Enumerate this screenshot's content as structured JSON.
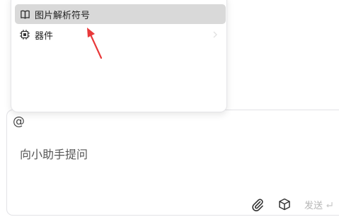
{
  "menu": {
    "items": [
      {
        "label": "图片解析符号",
        "icon": "book-open-icon",
        "active": true
      },
      {
        "label": "器件",
        "icon": "chip-icon",
        "active": false
      }
    ]
  },
  "annotation": {
    "color": "#e8393a"
  },
  "composer": {
    "mention_symbol": "@",
    "placeholder": "向小助手提问",
    "send_label": "发送"
  }
}
